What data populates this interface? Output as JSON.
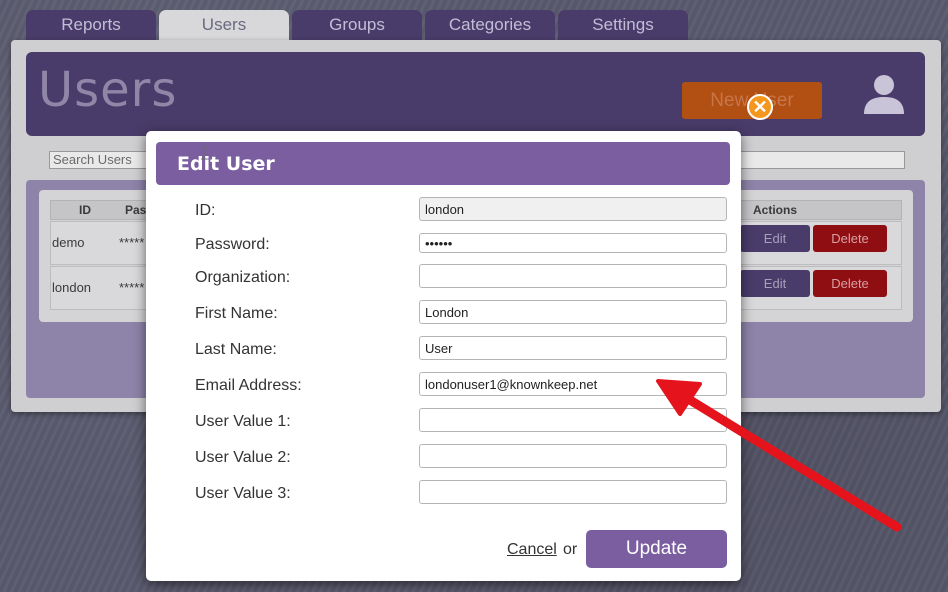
{
  "tabs": [
    {
      "label": "Reports"
    },
    {
      "label": "Users",
      "active": true
    },
    {
      "label": "Groups"
    },
    {
      "label": "Categories"
    },
    {
      "label": "Settings"
    }
  ],
  "header": {
    "title": "Users",
    "new_user_label": "New User"
  },
  "search": {
    "placeholder": "Search Users"
  },
  "table": {
    "columns": [
      "ID",
      "Pas",
      "Actions"
    ],
    "rows": [
      {
        "id": "demo",
        "password": "*****",
        "edit": "Edit",
        "delete": "Delete"
      },
      {
        "id": "london",
        "password": "*****",
        "edit": "Edit",
        "delete": "Delete"
      }
    ]
  },
  "modal": {
    "title": "Edit User",
    "close_symbol": "✕",
    "fields": [
      {
        "label": "ID:",
        "value": "london"
      },
      {
        "label": "Password:",
        "value": "••••••"
      },
      {
        "label": "Organization:",
        "value": ""
      },
      {
        "label": "First Name:",
        "value": "London"
      },
      {
        "label": "Last Name:",
        "value": "User"
      },
      {
        "label": "Email Address:",
        "value": "londonuser1@knownkeep.net"
      },
      {
        "label": "User Value 1:",
        "value": ""
      },
      {
        "label": "User Value 2:",
        "value": ""
      },
      {
        "label": "User Value 3:",
        "value": ""
      }
    ],
    "cancel_label": "Cancel",
    "or_label": "or",
    "update_label": "Update"
  },
  "colors": {
    "accent": "#7a5ea0",
    "header_dark": "#4a3c6a",
    "close": "#f5961d",
    "annotation_arrow": "#e5141c"
  }
}
